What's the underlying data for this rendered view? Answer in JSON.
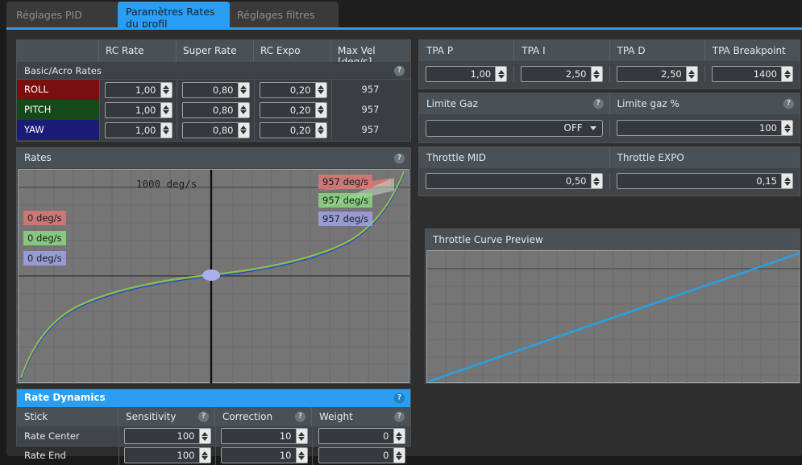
{
  "tabs": [
    {
      "label": "Réglages PID",
      "active": false
    },
    {
      "label": "Paramètres Rates du profil",
      "active": true
    },
    {
      "label": "Réglages filtres",
      "active": false
    }
  ],
  "rates_table": {
    "columns": [
      "",
      "RC Rate",
      "Super Rate",
      "RC Expo",
      "Max Vel [deg/s]"
    ],
    "section_label": "Basic/Acro Rates",
    "rows": [
      {
        "axis": "ROLL",
        "color": "#7a0f0f",
        "rc_rate": "1,00",
        "super_rate": "0,80",
        "rc_expo": "0,20",
        "max_vel": "957"
      },
      {
        "axis": "PITCH",
        "color": "#16491a",
        "rc_rate": "1,00",
        "super_rate": "0,80",
        "rc_expo": "0,20",
        "max_vel": "957"
      },
      {
        "axis": "YAW",
        "color": "#1b1b78",
        "rc_rate": "1,00",
        "super_rate": "0,80",
        "rc_expo": "0,20",
        "max_vel": "957"
      }
    ]
  },
  "rates_panel": {
    "title": "Rates",
    "axis_label": "1000 deg/s",
    "left_tags": [
      "0 deg/s",
      "0 deg/s",
      "0 deg/s"
    ],
    "right_tags": [
      "957 deg/s",
      "957 deg/s",
      "957 deg/s"
    ]
  },
  "rate_dynamics": {
    "title": "Rate Dynamics",
    "columns": [
      "Stick",
      "Sensitivity",
      "Correction",
      "Weight"
    ],
    "rows": [
      {
        "stick": "Rate Center",
        "sensitivity": "100",
        "correction": "10",
        "weight": "0"
      },
      {
        "stick": "Rate End",
        "sensitivity": "100",
        "correction": "10",
        "weight": "0"
      }
    ]
  },
  "tpa": {
    "fields": [
      {
        "label": "TPA P",
        "value": "1,00"
      },
      {
        "label": "TPA I",
        "value": "2,50"
      },
      {
        "label": "TPA D",
        "value": "2,50"
      },
      {
        "label": "TPA Breakpoint",
        "value": "1400"
      }
    ]
  },
  "throttle_limit": {
    "type_label": "Limite Gaz",
    "type_value": "OFF",
    "percent_label": "Limite gaz %",
    "percent_value": "100"
  },
  "throttle_curve": {
    "mid_label": "Throttle MID",
    "mid_value": "0,50",
    "expo_label": "Throttle EXPO",
    "expo_value": "0,15",
    "preview_title": "Throttle Curve Preview"
  },
  "colors": {
    "accent": "#2a9df4",
    "panel": "#3f4549",
    "header": "#4a5156",
    "plot_bg": "#757575",
    "roll": "#c94a4a",
    "pitch": "#4ec94e",
    "yaw": "#3a3ad0",
    "throttle_line": "#2a9fe0"
  },
  "chart_data": [
    {
      "type": "line",
      "title": "Rates",
      "xlabel": "",
      "ylabel": "deg/s",
      "xlim": [
        -1,
        1
      ],
      "ylim": [
        -1000,
        1000
      ],
      "grid": true,
      "annotations": [
        "1000 deg/s",
        "0 deg/s",
        "957 deg/s"
      ],
      "series": [
        {
          "name": "ROLL",
          "color": "#c94a4a",
          "max_deg_s": 957,
          "center_deg_s": 0
        },
        {
          "name": "PITCH",
          "color": "#4ec94e",
          "max_deg_s": 957,
          "center_deg_s": 0
        },
        {
          "name": "YAW",
          "color": "#3a3ad0",
          "max_deg_s": 957,
          "center_deg_s": 0
        }
      ],
      "x": [
        -1,
        -0.9,
        -0.8,
        -0.7,
        -0.6,
        -0.5,
        -0.4,
        -0.3,
        -0.2,
        -0.1,
        0,
        0.1,
        0.2,
        0.3,
        0.4,
        0.5,
        0.6,
        0.7,
        0.8,
        0.9,
        1
      ],
      "values": [
        -957,
        -660,
        -500,
        -392,
        -312,
        -248,
        -195,
        -148,
        -104,
        -58,
        0,
        58,
        104,
        148,
        195,
        248,
        312,
        392,
        500,
        660,
        957
      ]
    },
    {
      "type": "line",
      "title": "Throttle Curve Preview",
      "xlabel": "",
      "ylabel": "",
      "xlim": [
        0,
        1
      ],
      "ylim": [
        0,
        1
      ],
      "grid": true,
      "series": [
        {
          "name": "throttle",
          "color": "#2a9fe0"
        }
      ],
      "x": [
        0,
        0.25,
        0.5,
        0.75,
        1
      ],
      "values": [
        0,
        0.25,
        0.5,
        0.75,
        1
      ]
    }
  ]
}
